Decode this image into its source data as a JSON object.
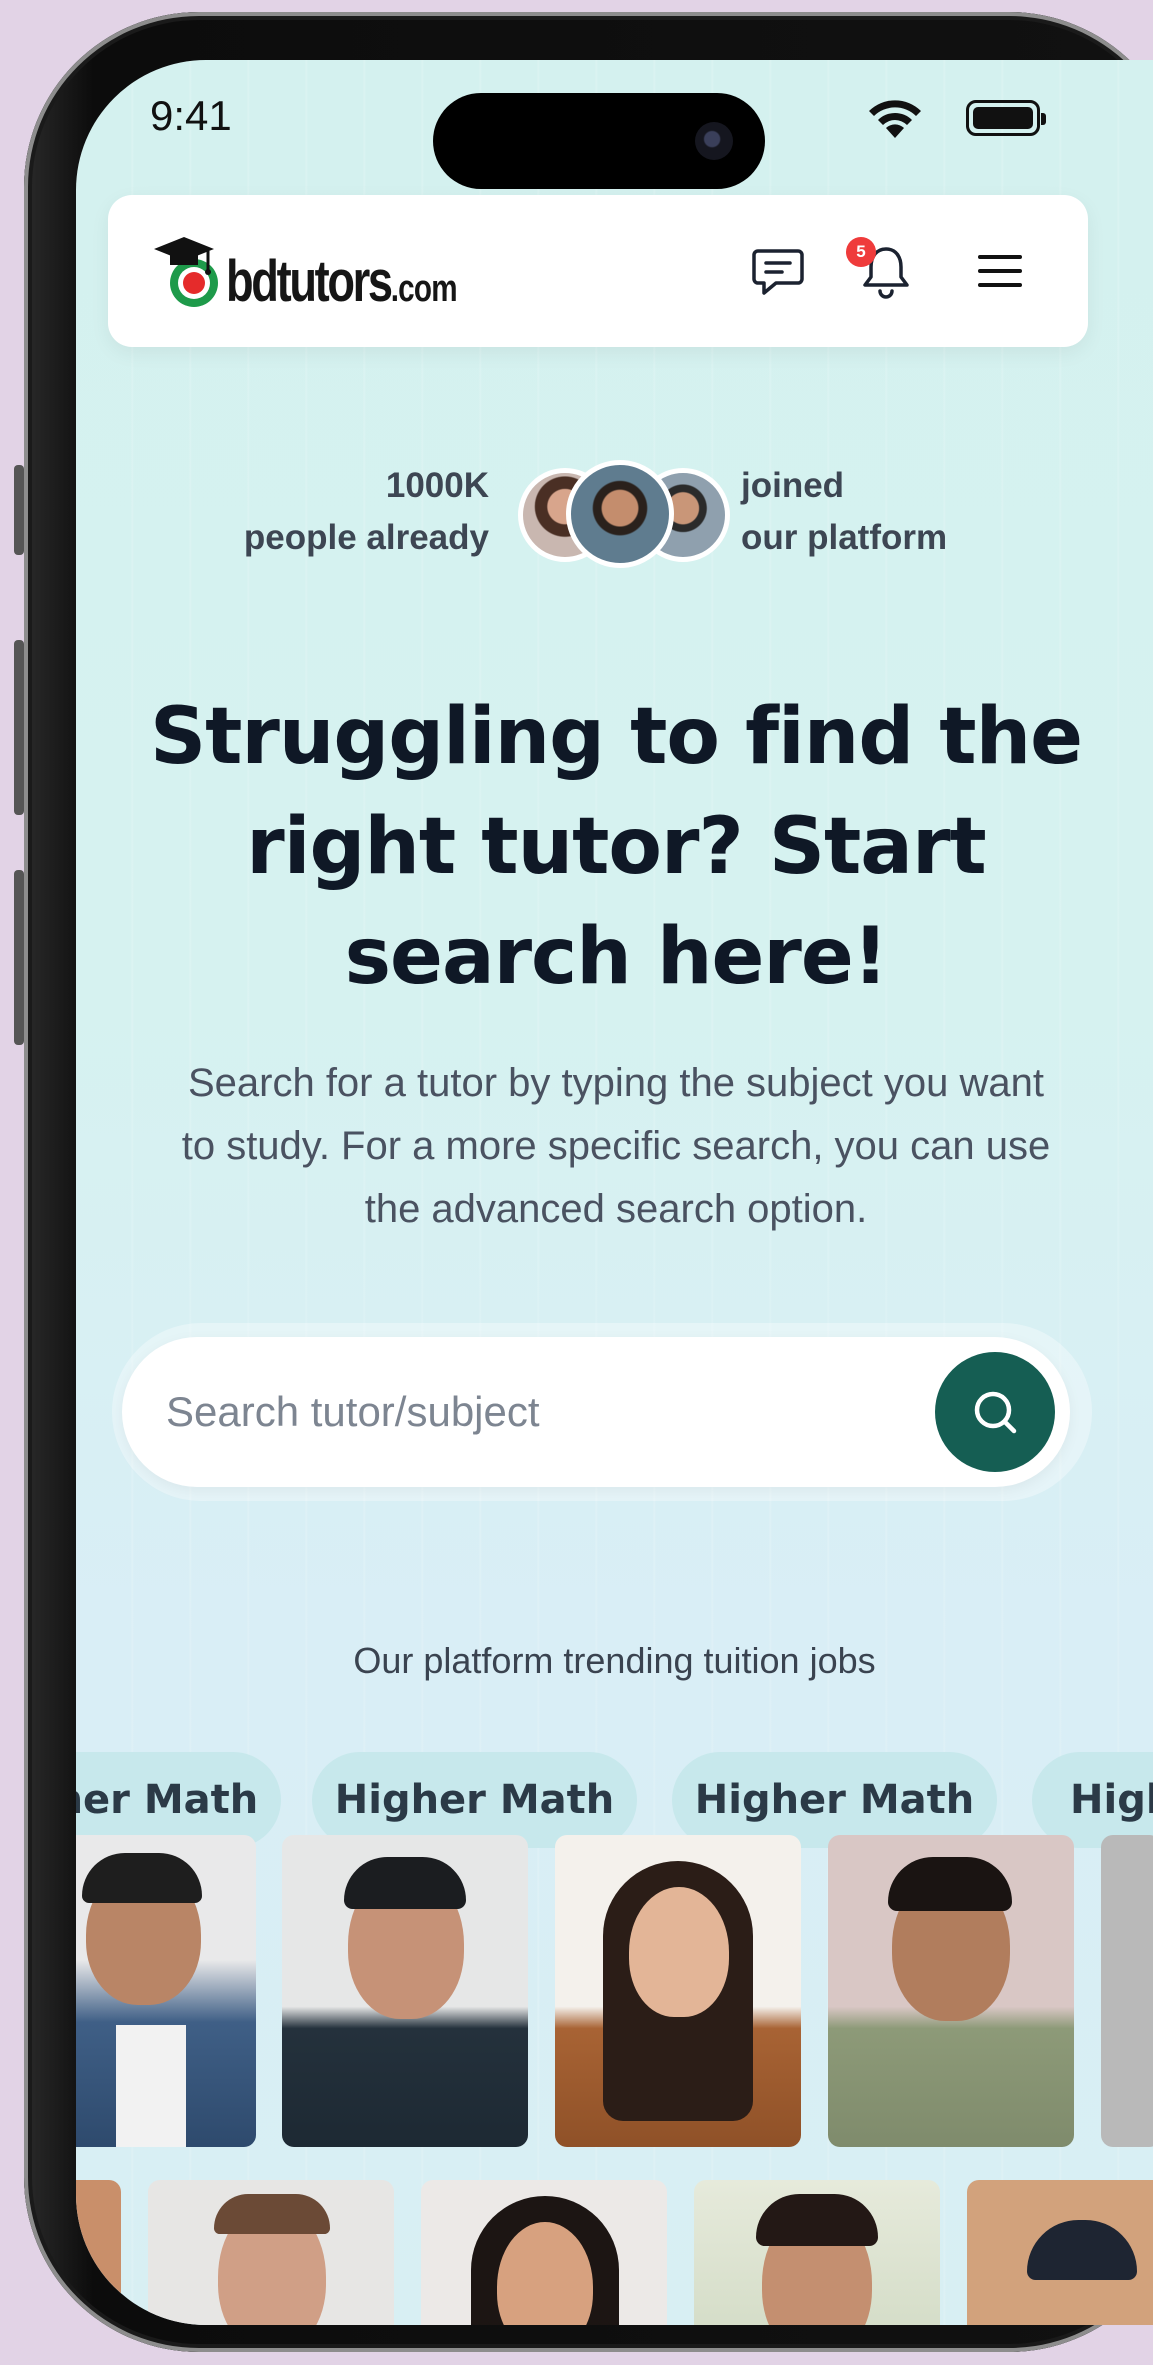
{
  "status_bar": {
    "time": "9:41"
  },
  "header": {
    "logo_text": "bdtutors",
    "logo_suffix": ".com",
    "notification_count": "5"
  },
  "social_proof": {
    "count": "1000K",
    "left_line2": "people already",
    "right_line1": "joined",
    "right_line2": "our platform"
  },
  "hero": {
    "headline": "Struggling to find the right tutor? Start search here!",
    "description": "Search for a tutor by typing the subject you want to study. For a more specific search, you can use the advanced search option."
  },
  "search": {
    "placeholder": "Search tutor/subject"
  },
  "trending": {
    "title": "Our platform trending tuition jobs",
    "chips": [
      "Higher Math",
      "Higher Math",
      "Higher Math",
      "Higher Math"
    ]
  },
  "colors": {
    "accent": "#155e53",
    "badge": "#ef3b3b",
    "chip_bg": "#c7e8ec",
    "headline": "#0f1826"
  }
}
